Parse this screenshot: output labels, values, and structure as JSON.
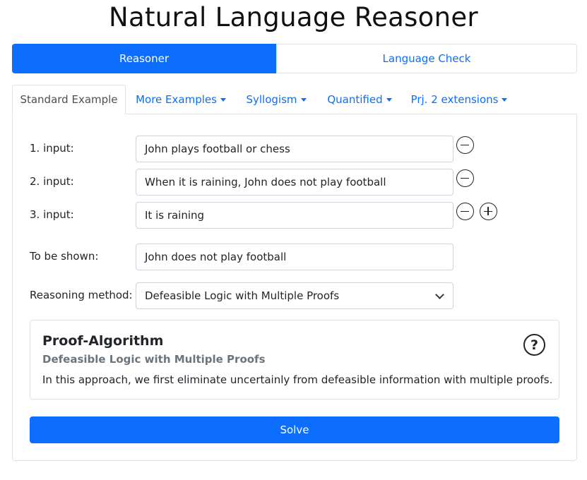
{
  "header": {
    "title": "Natural Language Reasoner"
  },
  "mode_toggle": {
    "active": "Reasoner",
    "inactive": "Language Check"
  },
  "tabs": [
    {
      "label": "Standard Example",
      "has_dropdown": false
    },
    {
      "label": "More Examples",
      "has_dropdown": true
    },
    {
      "label": "Syllogism",
      "has_dropdown": true
    },
    {
      "label": "Quantified",
      "has_dropdown": true
    },
    {
      "label": "Prj. 2 extensions",
      "has_dropdown": true
    }
  ],
  "inputs": [
    {
      "label": "1. input:",
      "value": "John plays football or chess"
    },
    {
      "label": "2. input:",
      "value": "When it is raining, John does not play football"
    },
    {
      "label": "3. input:",
      "value": "It is raining"
    }
  ],
  "to_be_shown": {
    "label": "To be shown:",
    "value": "John does not play football"
  },
  "reasoning": {
    "label": "Reasoning method:",
    "selected": "Defeasible Logic with Multiple Proofs"
  },
  "card": {
    "title": "Proof-Algorithm",
    "subtitle": "Defeasible Logic with Multiple Proofs",
    "text": "In this approach, we first eliminate uncertainly from defeasible information with multiple proofs.",
    "help_glyph": "?"
  },
  "solve": {
    "label": "Solve"
  },
  "colors": {
    "primary": "#0d6efd",
    "border": "#dee2e6",
    "muted": "#6c757d"
  }
}
